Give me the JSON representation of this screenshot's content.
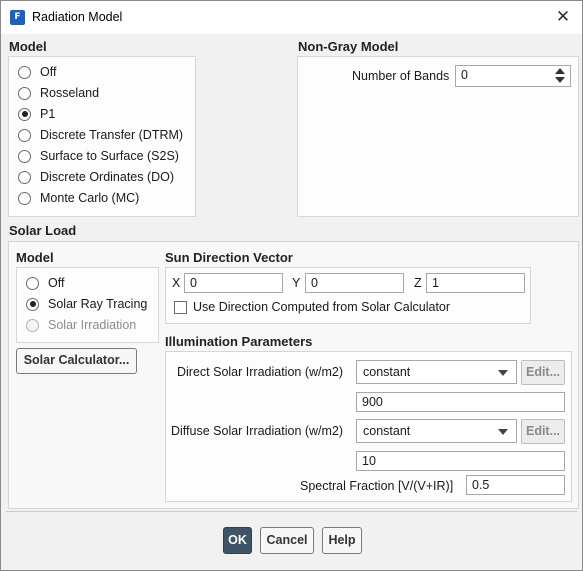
{
  "window": {
    "title": "Radiation Model",
    "app_icon_glyph": "F",
    "close_glyph": "✕"
  },
  "model": {
    "title": "Model",
    "options": [
      {
        "label": "Off",
        "checked": false
      },
      {
        "label": "Rosseland",
        "checked": false
      },
      {
        "label": "P1",
        "checked": true
      },
      {
        "label": "Discrete Transfer (DTRM)",
        "checked": false
      },
      {
        "label": "Surface to Surface (S2S)",
        "checked": false
      },
      {
        "label": "Discrete Ordinates (DO)",
        "checked": false
      },
      {
        "label": "Monte Carlo (MC)",
        "checked": false
      }
    ]
  },
  "non_gray": {
    "title": "Non-Gray Model",
    "bands_label": "Number of Bands",
    "bands_value": "0"
  },
  "solar_load": {
    "title": "Solar Load",
    "model_title": "Model",
    "options": [
      {
        "label": "Off",
        "checked": false,
        "disabled": false
      },
      {
        "label": "Solar Ray Tracing",
        "checked": true,
        "disabled": false
      },
      {
        "label": "Solar Irradiation",
        "checked": false,
        "disabled": true
      }
    ],
    "calculator_button": "Solar Calculator...",
    "sun_direction": {
      "title": "Sun Direction Vector",
      "x_label": "X",
      "x_value": "0",
      "y_label": "Y",
      "y_value": "0",
      "z_label": "Z",
      "z_value": "1",
      "checkbox_label": "Use Direction Computed from Solar Calculator",
      "checkbox_checked": false
    },
    "illumination": {
      "title": "Illumination Parameters",
      "direct_label": "Direct Solar Irradiation (w/m2)",
      "direct_method": "constant",
      "direct_value": "900",
      "diffuse_label": "Diffuse Solar Irradiation (w/m2)",
      "diffuse_method": "constant",
      "diffuse_value": "10",
      "edit_label": "Edit...",
      "spectral_label": "Spectral Fraction [V/(V+IR)]",
      "spectral_value": "0.5"
    }
  },
  "footer": {
    "ok": "OK",
    "cancel": "Cancel",
    "help": "Help"
  }
}
